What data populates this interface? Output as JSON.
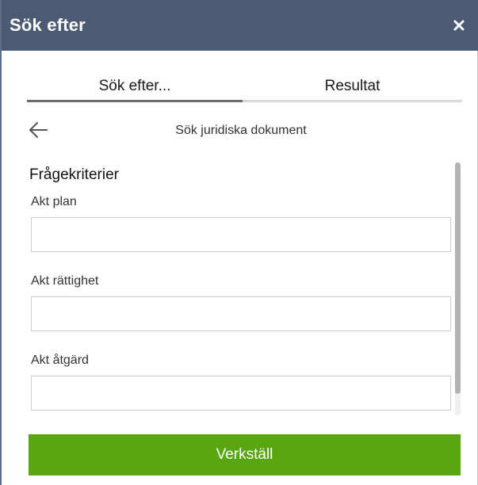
{
  "window": {
    "title": "Sök efter",
    "close_icon": "close-icon"
  },
  "tabs": [
    {
      "label": "Sök efter...",
      "active": true
    },
    {
      "label": "Resultat",
      "active": false
    }
  ],
  "navigation": {
    "back_icon": "arrow-left-icon",
    "subtitle": "Sök juridiska dokument"
  },
  "criteria": {
    "heading": "Frågekriterier",
    "fields": [
      {
        "label": "Akt plan",
        "value": "",
        "placeholder": ""
      },
      {
        "label": "Akt rättighet",
        "value": "",
        "placeholder": ""
      },
      {
        "label": "Akt åtgärd",
        "value": "",
        "placeholder": ""
      }
    ]
  },
  "actions": {
    "apply_label": "Verkställ"
  },
  "colors": {
    "titlebar": "#4c5b73",
    "apply_button": "#58a711",
    "active_tab_indicator": "#6b6b6b"
  }
}
